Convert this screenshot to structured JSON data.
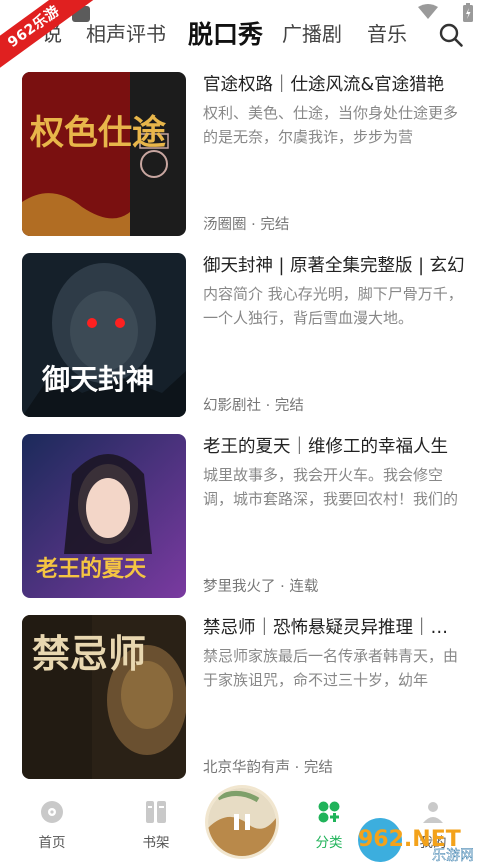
{
  "badge": {
    "text": "962乐游"
  },
  "tabs": [
    {
      "label": "说"
    },
    {
      "label": "相声评书"
    },
    {
      "label": "脱口秀"
    },
    {
      "label": "广播剧"
    },
    {
      "label": "音乐"
    }
  ],
  "items": [
    {
      "title": "官途权路｜仕途风流&官途猎艳",
      "desc": "权利、美色、仕途，当你身处仕途更多的是无奈，尔虞我诈，步步为营",
      "meta": "汤圈圈 · 完结",
      "cover_text": "权色仕途"
    },
    {
      "title": "御天封神 | 原著全集完整版 | 玄幻",
      "desc": "内容简介 我心存光明，脚下尸骨万千，一个人独行，背后雪血漫大地。",
      "meta": "幻影剧社 · 完结",
      "cover_text": "御天封神"
    },
    {
      "title": "老王的夏天｜维修工的幸福人生",
      "desc": "城里故事多，我会开火车。我会修空调，城市套路深，我要回农村！我们的",
      "meta": "梦里我火了 · 连载",
      "cover_text": "老王的夏天"
    },
    {
      "title": "禁忌师｜恐怖悬疑灵异推理｜多人",
      "desc": "禁忌师家族最后一名传承者韩青天，由于家族诅咒，命不过三十岁，幼年",
      "meta": "北京华韵有声 · 完结",
      "cover_text": "禁忌师"
    }
  ],
  "nav": [
    {
      "label": "首页"
    },
    {
      "label": "书架"
    },
    {
      "label": "分类"
    },
    {
      "label": "我的"
    }
  ],
  "watermark": {
    "main": "962.NET",
    "sub": "乐游网"
  },
  "colors": {
    "accent": "#20b35a",
    "badge": "#e02020"
  }
}
